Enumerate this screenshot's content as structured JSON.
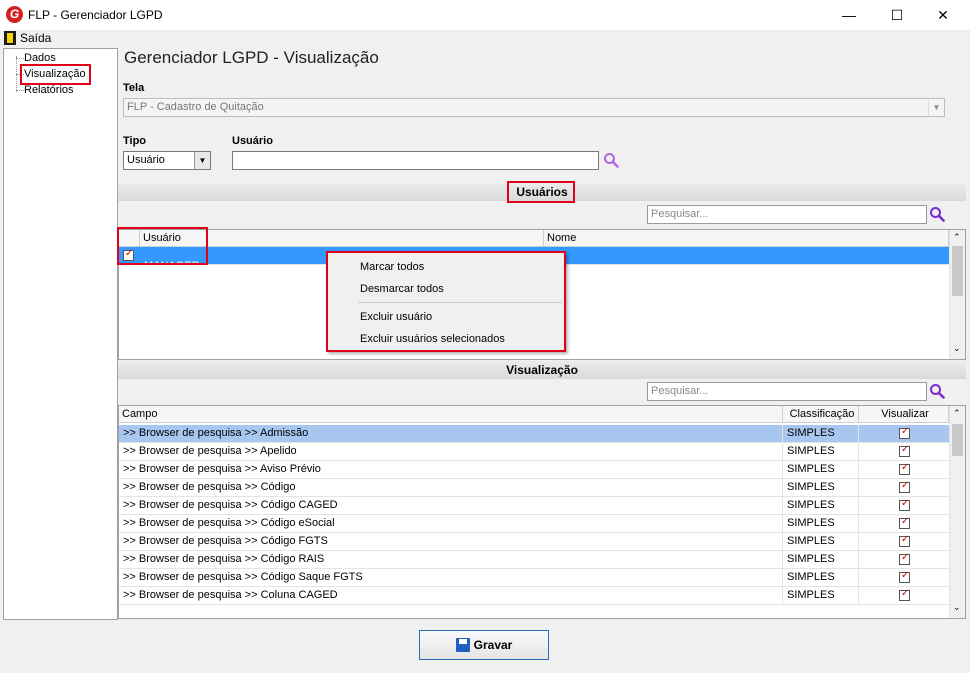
{
  "window": {
    "title": "FLP - Gerenciador LGPD",
    "minimize": "—",
    "maximize": "☐",
    "close": "✕",
    "logo_letter": "G"
  },
  "menu": {
    "exit_label": "Saída"
  },
  "tree": {
    "items": [
      {
        "label": "Dados"
      },
      {
        "label": "Visualização"
      },
      {
        "label": "Relatórios"
      }
    ]
  },
  "page": {
    "title": "Gerenciador LGPD - Visualização"
  },
  "tela": {
    "label": "Tela",
    "value": "FLP - Cadastro de Quitação"
  },
  "tipo": {
    "label": "Tipo",
    "value": "Usuário"
  },
  "usuario": {
    "label": "Usuário",
    "value": ""
  },
  "usuarios_section": {
    "title": "Usuários",
    "search_placeholder": "Pesquisar...",
    "columns": [
      "Usuário",
      "Nome"
    ],
    "rows": [
      {
        "checked": true,
        "usuario": "MANAGER",
        "nome": ""
      }
    ]
  },
  "context_menu": {
    "items": [
      "Marcar todos",
      "Desmarcar todos",
      "Excluir usuário",
      "Excluir usuários selecionados"
    ]
  },
  "visualizacao_section": {
    "title": "Visualização",
    "search_placeholder": "Pesquisar...",
    "columns": [
      "Campo",
      "Classificação",
      "Visualizar"
    ],
    "rows": [
      {
        "campo": ">> Browser de pesquisa >> Admissão",
        "classificacao": "SIMPLES",
        "visualizar": true
      },
      {
        "campo": ">> Browser de pesquisa >> Apelido",
        "classificacao": "SIMPLES",
        "visualizar": true
      },
      {
        "campo": ">> Browser de pesquisa >> Aviso Prévio",
        "classificacao": "SIMPLES",
        "visualizar": true
      },
      {
        "campo": ">> Browser de pesquisa >> Código",
        "classificacao": "SIMPLES",
        "visualizar": true
      },
      {
        "campo": ">> Browser de pesquisa >> Código CAGED",
        "classificacao": "SIMPLES",
        "visualizar": true
      },
      {
        "campo": ">> Browser de pesquisa >> Código eSocial",
        "classificacao": "SIMPLES",
        "visualizar": true
      },
      {
        "campo": ">> Browser de pesquisa >> Código FGTS",
        "classificacao": "SIMPLES",
        "visualizar": true
      },
      {
        "campo": ">> Browser de pesquisa >> Código RAIS",
        "classificacao": "SIMPLES",
        "visualizar": true
      },
      {
        "campo": ">> Browser de pesquisa >> Código Saque FGTS",
        "classificacao": "SIMPLES",
        "visualizar": true
      },
      {
        "campo": ">> Browser de pesquisa >> Coluna CAGED",
        "classificacao": "SIMPLES",
        "visualizar": true
      }
    ]
  },
  "footer": {
    "save_label": "Gravar"
  },
  "colors": {
    "selection": "#3399ff",
    "first_row": "#a8c7f0",
    "highlight": "#e0001a",
    "search_icon": "#7a2bd4"
  }
}
